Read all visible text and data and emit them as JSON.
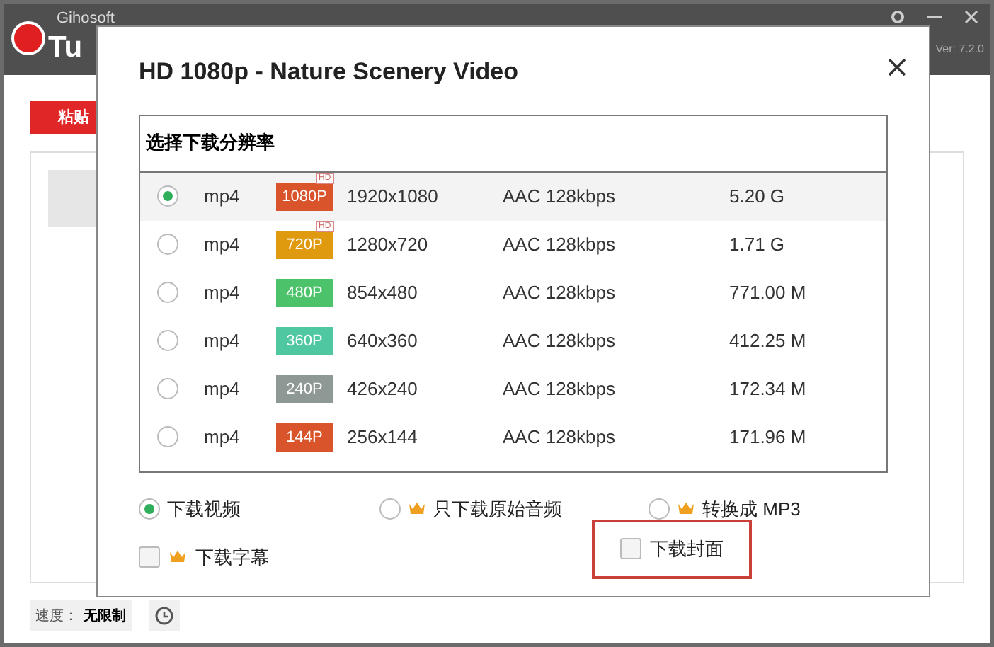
{
  "app": {
    "brand": "Gihosoft",
    "title": "Tu",
    "version": "Ver: 7.2.0",
    "paste_button": "粘贴",
    "speed_label": "速度：",
    "speed_value": "无限制"
  },
  "dialog": {
    "title": "HD 1080p - Nature Scenery Video",
    "section_title": "选择下载分辨率",
    "rows": [
      {
        "format": "mp4",
        "badge": "1080P",
        "color": "#d9532b",
        "hd_tag": "HD",
        "resolution": "1920x1080",
        "audio": "AAC 128kbps",
        "size": "5.20 G",
        "selected": true
      },
      {
        "format": "mp4",
        "badge": "720P",
        "color": "#e09a10",
        "hd_tag": "HD",
        "resolution": "1280x720",
        "audio": "AAC 128kbps",
        "size": "1.71 G",
        "selected": false
      },
      {
        "format": "mp4",
        "badge": "480P",
        "color": "#4cc36a",
        "resolution": "854x480",
        "audio": "AAC 128kbps",
        "size": "771.00 M",
        "selected": false
      },
      {
        "format": "mp4",
        "badge": "360P",
        "color": "#4fc7a0",
        "resolution": "640x360",
        "audio": "AAC 128kbps",
        "size": "412.25 M",
        "selected": false
      },
      {
        "format": "mp4",
        "badge": "240P",
        "color": "#8e9894",
        "resolution": "426x240",
        "audio": "AAC 128kbps",
        "size": "172.34 M",
        "selected": false
      },
      {
        "format": "mp4",
        "badge": "144P",
        "color": "#d9532b",
        "resolution": "256x144",
        "audio": "AAC 128kbps",
        "size": "171.96 M",
        "selected": false
      }
    ],
    "options": [
      {
        "label": "下载视频",
        "premium": false,
        "selected": true
      },
      {
        "label": "只下载原始音频",
        "premium": true,
        "selected": false
      },
      {
        "label": "转换成 MP3",
        "premium": true,
        "selected": false
      }
    ],
    "checkboxes": [
      {
        "label": "下载字幕",
        "premium": true,
        "checked": false,
        "highlighted": false
      },
      {
        "label": "下载封面",
        "premium": false,
        "checked": false,
        "highlighted": true
      }
    ]
  }
}
